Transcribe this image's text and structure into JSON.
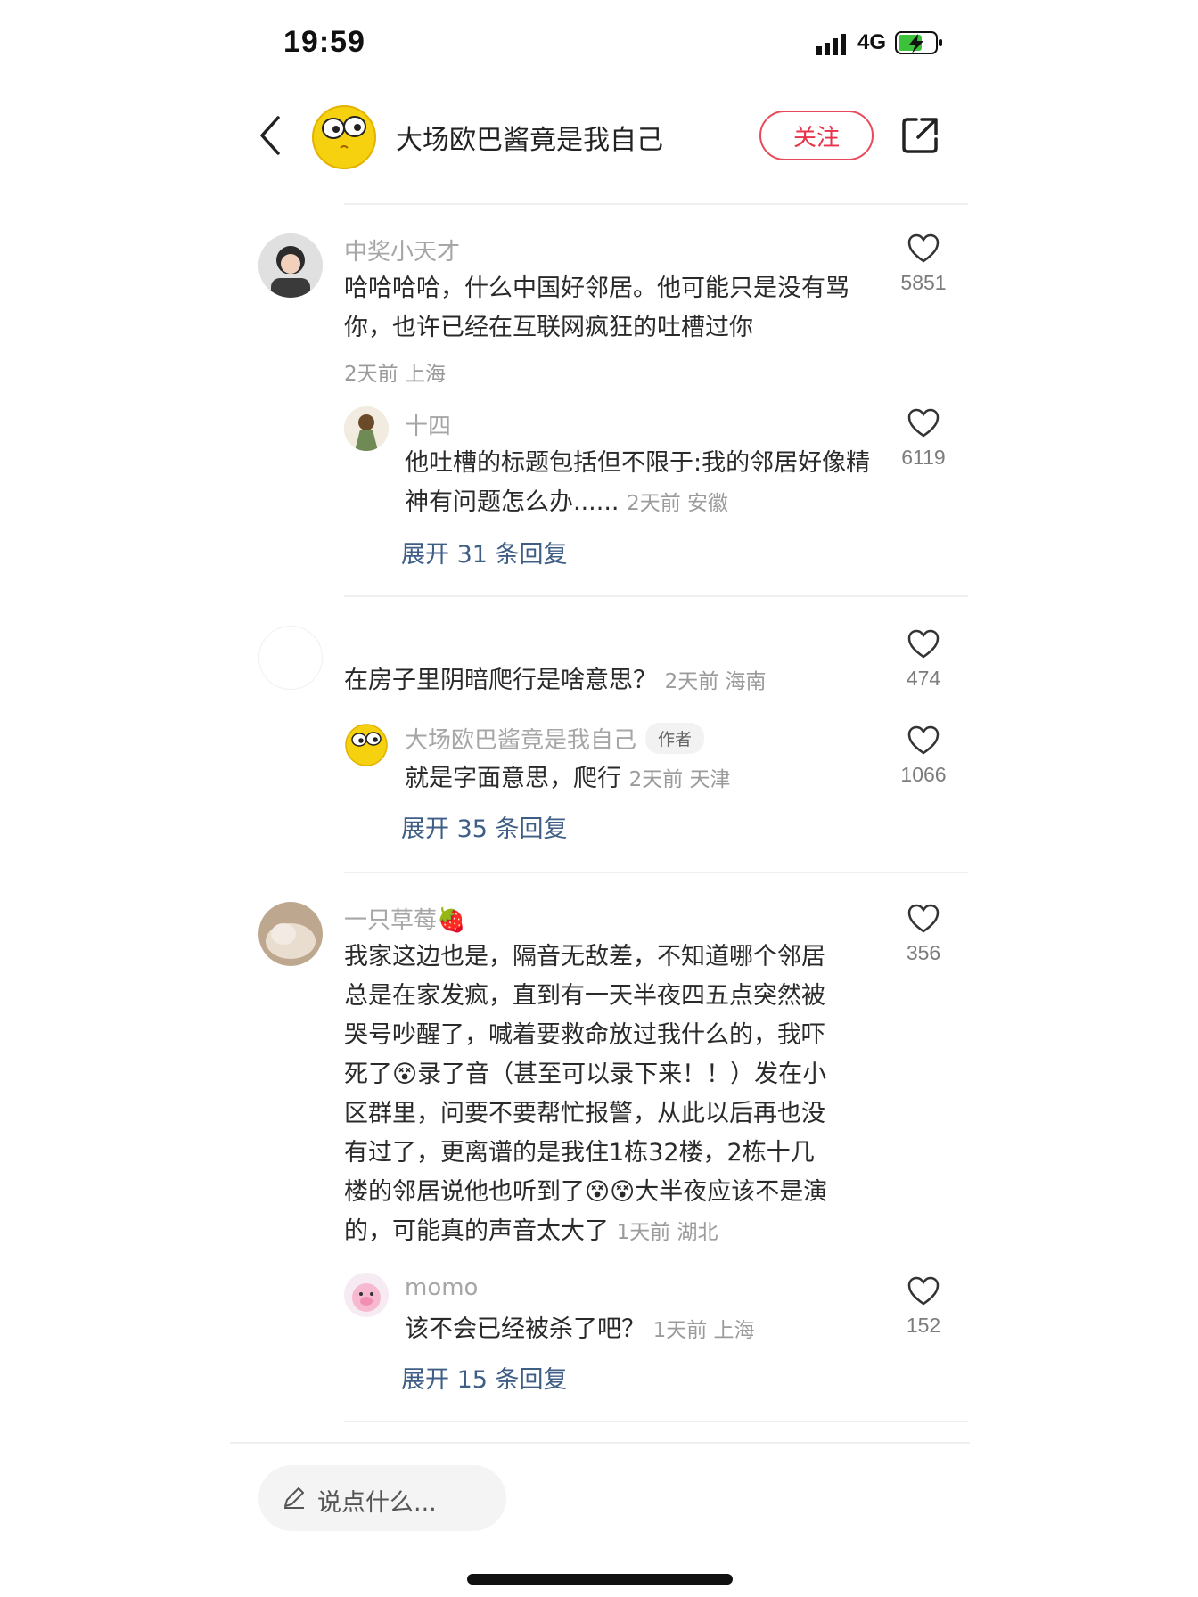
{
  "status_bar": {
    "time": "19:59",
    "network": "4G"
  },
  "header": {
    "title": "大场欧巴酱竟是我自己",
    "follow_label": "关注"
  },
  "comments": [
    {
      "user": "中奖小天才",
      "text": "哈哈哈哈，什么中国好邻居。他可能只是没有骂你，也许已经在互联网疯狂的吐槽过你",
      "meta": "2天前 上海",
      "likes": "5851",
      "reply": {
        "user": "十四",
        "text": "他吐槽的标题包括但不限于:我的邻居好像精神有问题怎么办......",
        "meta": "2天前 安徽",
        "likes": "6119"
      },
      "expand_label": "展开 31 条回复"
    },
    {
      "user": "",
      "text": "在房子里阴暗爬行是啥意思？",
      "meta": "2天前 海南",
      "likes": "474",
      "reply": {
        "user": "大场欧巴酱竟是我自己",
        "badge": "作者",
        "text": "就是字面意思，爬行",
        "meta": "2天前 天津",
        "likes": "1066"
      },
      "expand_label": "展开 35 条回复"
    },
    {
      "user": "一只草莓🍓",
      "text_lines": [
        "我家这边也是，隔音无敌差，不知道哪个邻居",
        "总是在家发疯，直到有一天半夜四五点突然被",
        "哭号吵醒了，喊着要救命放过我什么的，我吓",
        "死了😵录了音（甚至可以录下来！！）发在小",
        "区群里，问要不要帮忙报警，从此以后再也没",
        "有过了，更离谱的是我住1栋32楼，2栋十几",
        "楼的邻居说他也听到了😵😵大半夜应该不是演",
        "的，可能真的声音太大了"
      ],
      "meta": "1天前 湖北",
      "likes": "356",
      "reply": {
        "user": "momo",
        "text": "该不会已经被杀了吧？",
        "meta": "1天前 上海",
        "likes": "152"
      },
      "expand_label": "展开 15 条回复"
    }
  ],
  "input": {
    "placeholder": "说点什么..."
  },
  "colors": {
    "accent": "#e8334a",
    "link": "#3f5e86",
    "meta": "#9b9b9b"
  }
}
